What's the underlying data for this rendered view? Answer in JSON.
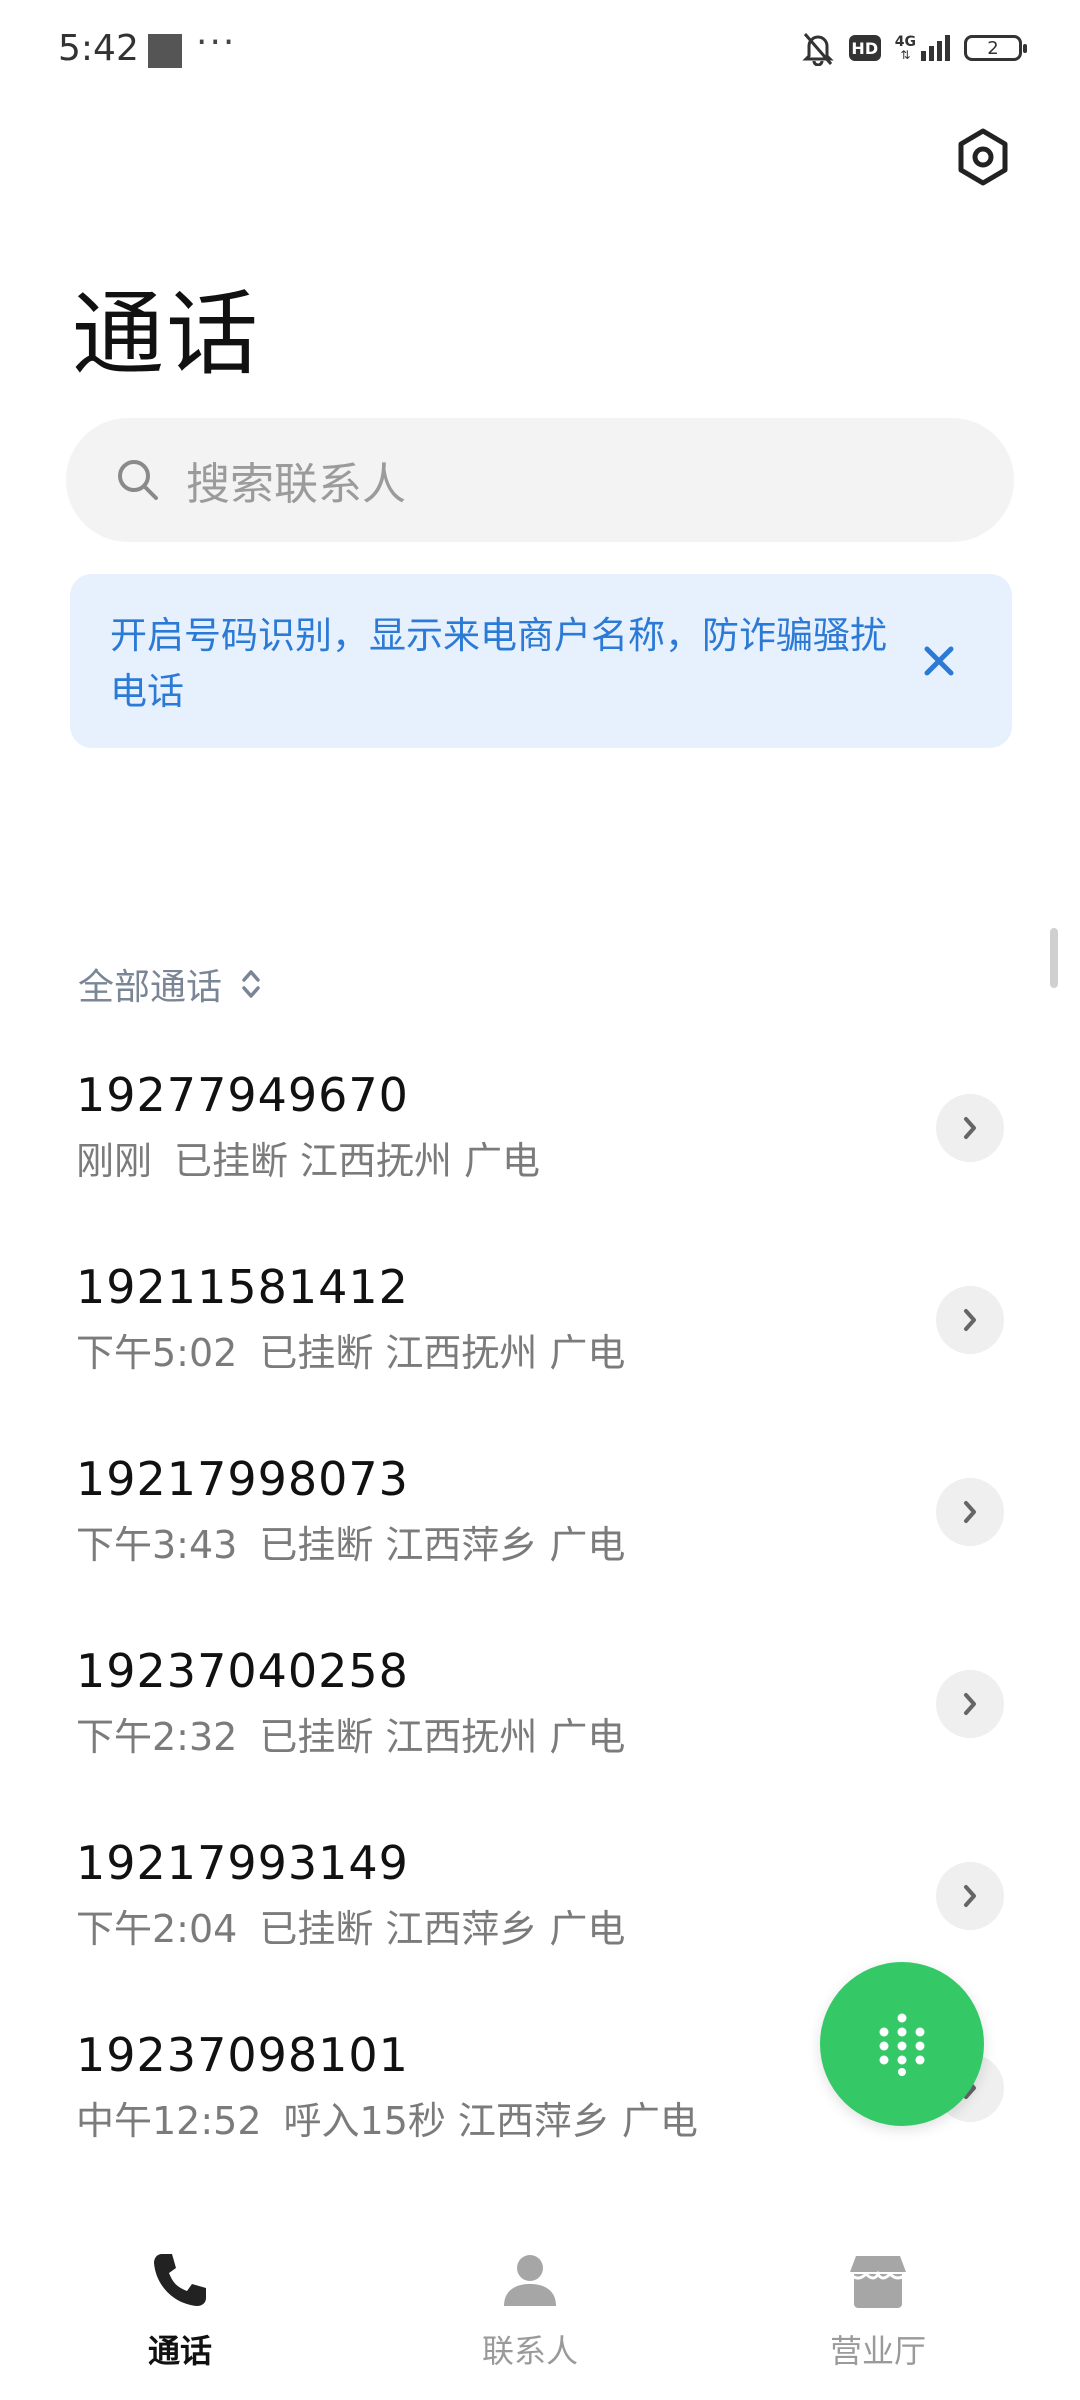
{
  "status_bar": {
    "time": "5:42",
    "more": "···",
    "hd": "HD",
    "network": "4G",
    "battery": "2"
  },
  "header": {
    "title": "通话",
    "settings_icon": "hexagon-settings-icon"
  },
  "search": {
    "placeholder": "搜索联系人"
  },
  "notice": {
    "text": "开启号码识别，显示来电商户名称，防诈骗骚扰电话",
    "close_icon": "close-icon",
    "accent": "#2b7ad6"
  },
  "filter": {
    "label": "全部通话"
  },
  "calls": [
    {
      "number": "19277949670",
      "time": "刚刚",
      "status": "已挂断",
      "location": "江西抚州",
      "carrier": "广电"
    },
    {
      "number": "19211581412",
      "time": "下午5:02",
      "status": "已挂断",
      "location": "江西抚州",
      "carrier": "广电"
    },
    {
      "number": "19217998073",
      "time": "下午3:43",
      "status": "已挂断",
      "location": "江西萍乡",
      "carrier": "广电"
    },
    {
      "number": "19237040258",
      "time": "下午2:32",
      "status": "已挂断",
      "location": "江西抚州",
      "carrier": "广电"
    },
    {
      "number": "19217993149",
      "time": "下午2:04",
      "status": "已挂断",
      "location": "江西萍乡",
      "carrier": "广电"
    },
    {
      "number": "19237098101",
      "time": "中午12:52",
      "status": "呼入15秒",
      "location": "江西萍乡",
      "carrier": "广电"
    }
  ],
  "fab": {
    "icon": "dialpad-icon",
    "color": "#35c867"
  },
  "bottom_nav": {
    "items": [
      {
        "label": "通话",
        "icon": "phone-icon",
        "active": true
      },
      {
        "label": "联系人",
        "icon": "person-icon",
        "active": false
      },
      {
        "label": "营业厅",
        "icon": "store-icon",
        "active": false
      }
    ]
  }
}
